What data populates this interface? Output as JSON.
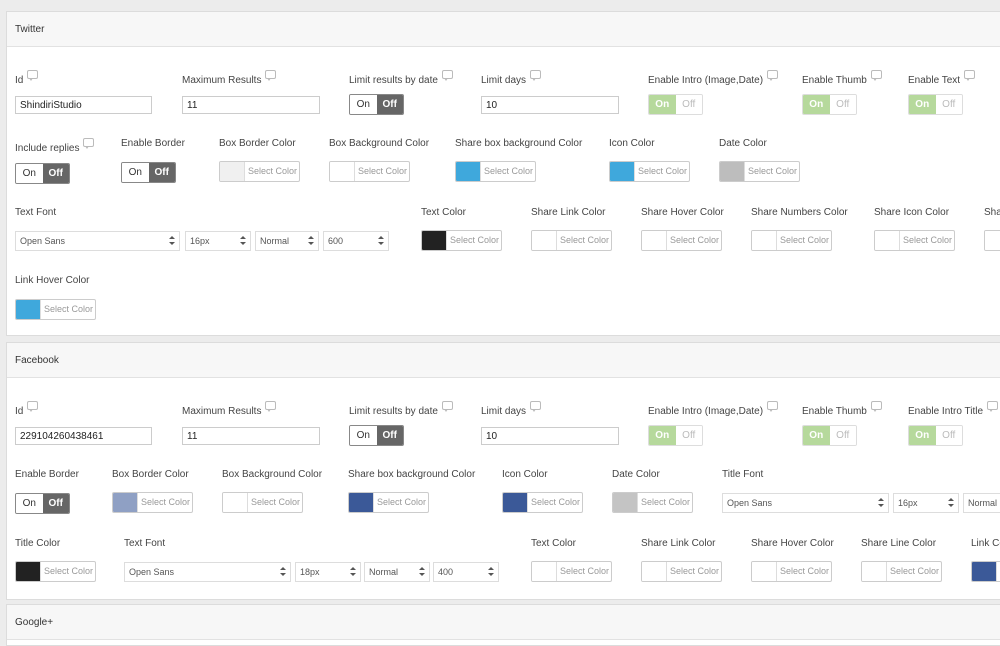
{
  "twitter": {
    "title": "Twitter",
    "id_label": "Id",
    "id_value": "ShindiriStudio",
    "max_results_label": "Maximum Results",
    "max_results_value": "11",
    "limit_date_label": "Limit results by date",
    "limit_days_label": "Limit days",
    "limit_days_value": "10",
    "enable_intro_label": "Enable Intro (Image,Date)",
    "enable_thumb_label": "Enable Thumb",
    "enable_text_label": "Enable Text",
    "include_replies_label": "Include replies",
    "enable_border_label": "Enable Border",
    "box_border_color_label": "Box Border Color",
    "box_bg_color_label": "Box Background Color",
    "share_box_bg_label": "Share box background Color",
    "icon_color_label": "Icon Color",
    "date_color_label": "Date Color",
    "text_font_label": "Text Font",
    "font_family": "Open Sans",
    "font_size": "16px",
    "font_style": "Normal",
    "font_weight": "600",
    "text_color_label": "Text Color",
    "share_link_color_label": "Share Link Color",
    "share_hover_color_label": "Share Hover Color",
    "share_numbers_color_label": "Share Numbers Color",
    "share_icon_color_label": "Share Icon Color",
    "share_cut_label": "Sha",
    "link_hover_color_label": "Link Hover Color"
  },
  "facebook": {
    "title": "Facebook",
    "id_label": "Id",
    "id_value": "229104260438461",
    "max_results_label": "Maximum Results",
    "max_results_value": "11",
    "limit_date_label": "Limit results by date",
    "limit_days_label": "Limit days",
    "limit_days_value": "10",
    "enable_intro_label": "Enable Intro (Image,Date)",
    "enable_thumb_label": "Enable Thumb",
    "enable_intro_title_label": "Enable Intro Title",
    "enable_border_label": "Enable Border",
    "box_border_color_label": "Box Border Color",
    "box_bg_color_label": "Box Background Color",
    "share_box_bg_label": "Share box background Color",
    "icon_color_label": "Icon Color",
    "date_color_label": "Date Color",
    "title_font_label": "Title Font",
    "title_font_family": "Open Sans",
    "title_font_size": "16px",
    "title_font_style": "Normal",
    "title_color_label": "Title Color",
    "text_font_label": "Text Font",
    "font_family": "Open Sans",
    "font_size": "18px",
    "font_style": "Normal",
    "font_weight": "400",
    "text_color_label": "Text Color",
    "share_link_color_label": "Share Link Color",
    "share_hover_color_label": "Share Hover Color",
    "share_line_color_label": "Share Line Color",
    "link_cut_label": "Link Co"
  },
  "google": {
    "title": "Google+"
  },
  "common": {
    "on": "On",
    "off": "Off",
    "select_color": "Select Color"
  },
  "colors": {
    "white": "#ffffff",
    "light_gray": "#f0f0f0",
    "gray": "#bdbdbd",
    "blue": "#3fa8dc",
    "black": "#222222",
    "fb_light": "#8fa0c4",
    "fb_blue": "#3b5998"
  }
}
